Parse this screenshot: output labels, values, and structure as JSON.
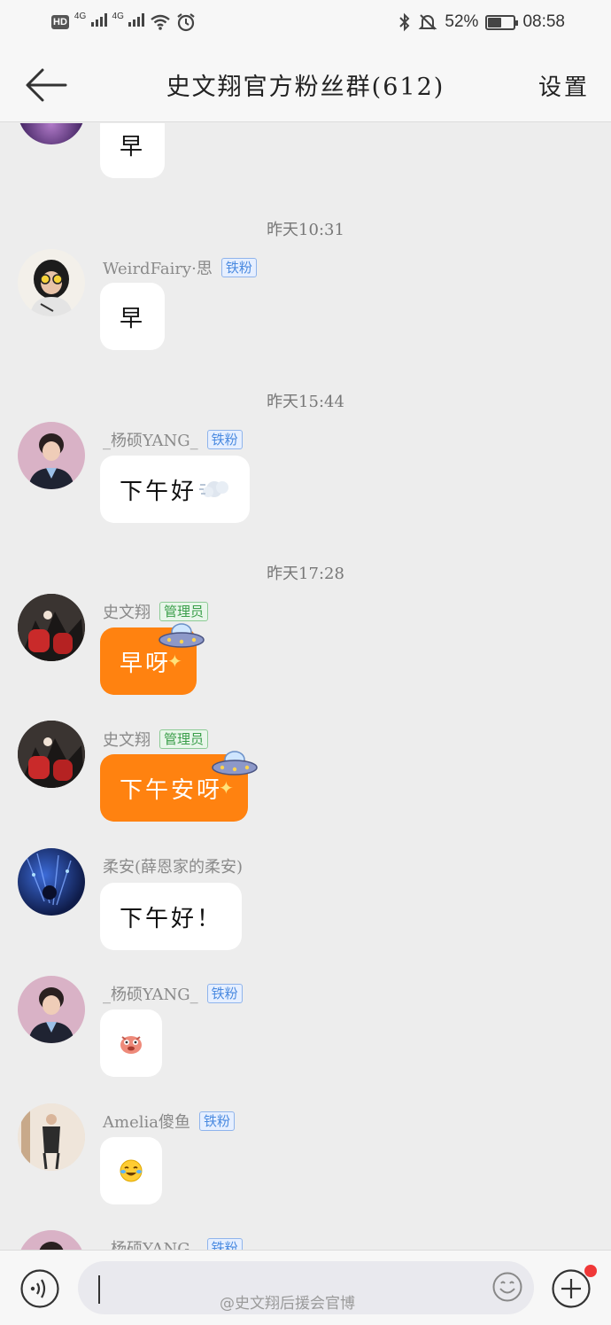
{
  "status_bar": {
    "network_left_1": "4G",
    "network_left_2": "4G",
    "battery": "52%",
    "time": "08:58",
    "battery_level": 0.52
  },
  "header": {
    "title": "史文翔官方粉丝群(612)",
    "settings_label": "设置"
  },
  "messages": [
    {
      "text": "早"
    },
    {
      "timestamp": "昨天10:31",
      "sender": "WeirdFairy·思",
      "badge": "铁粉",
      "text": "早"
    },
    {
      "timestamp": "昨天15:44",
      "sender": "_杨硕YANG_",
      "badge": "铁粉",
      "text": "下午好"
    },
    {
      "timestamp": "昨天17:28",
      "sender": "史文翔",
      "badge": "管理员",
      "text": "早呀"
    },
    {
      "sender": "史文翔",
      "badge": "管理员",
      "text": "下午安呀"
    },
    {
      "sender": "柔安(薛恩家的柔安)",
      "text": "下午好！"
    },
    {
      "sender": "_杨硕YANG_",
      "badge": "铁粉"
    },
    {
      "sender": "Amelia傻鱼",
      "badge": "铁粉"
    },
    {
      "sender": "_杨硕YANG_",
      "badge": "铁粉"
    }
  ],
  "input": {
    "placeholder": ""
  },
  "watermark": "@史文翔后援会官博",
  "colors": {
    "accent_orange": "#ff8210",
    "fan_badge": "#4a8ae0",
    "admin_badge": "#3a9e4a",
    "notification_dot": "#f03838"
  }
}
